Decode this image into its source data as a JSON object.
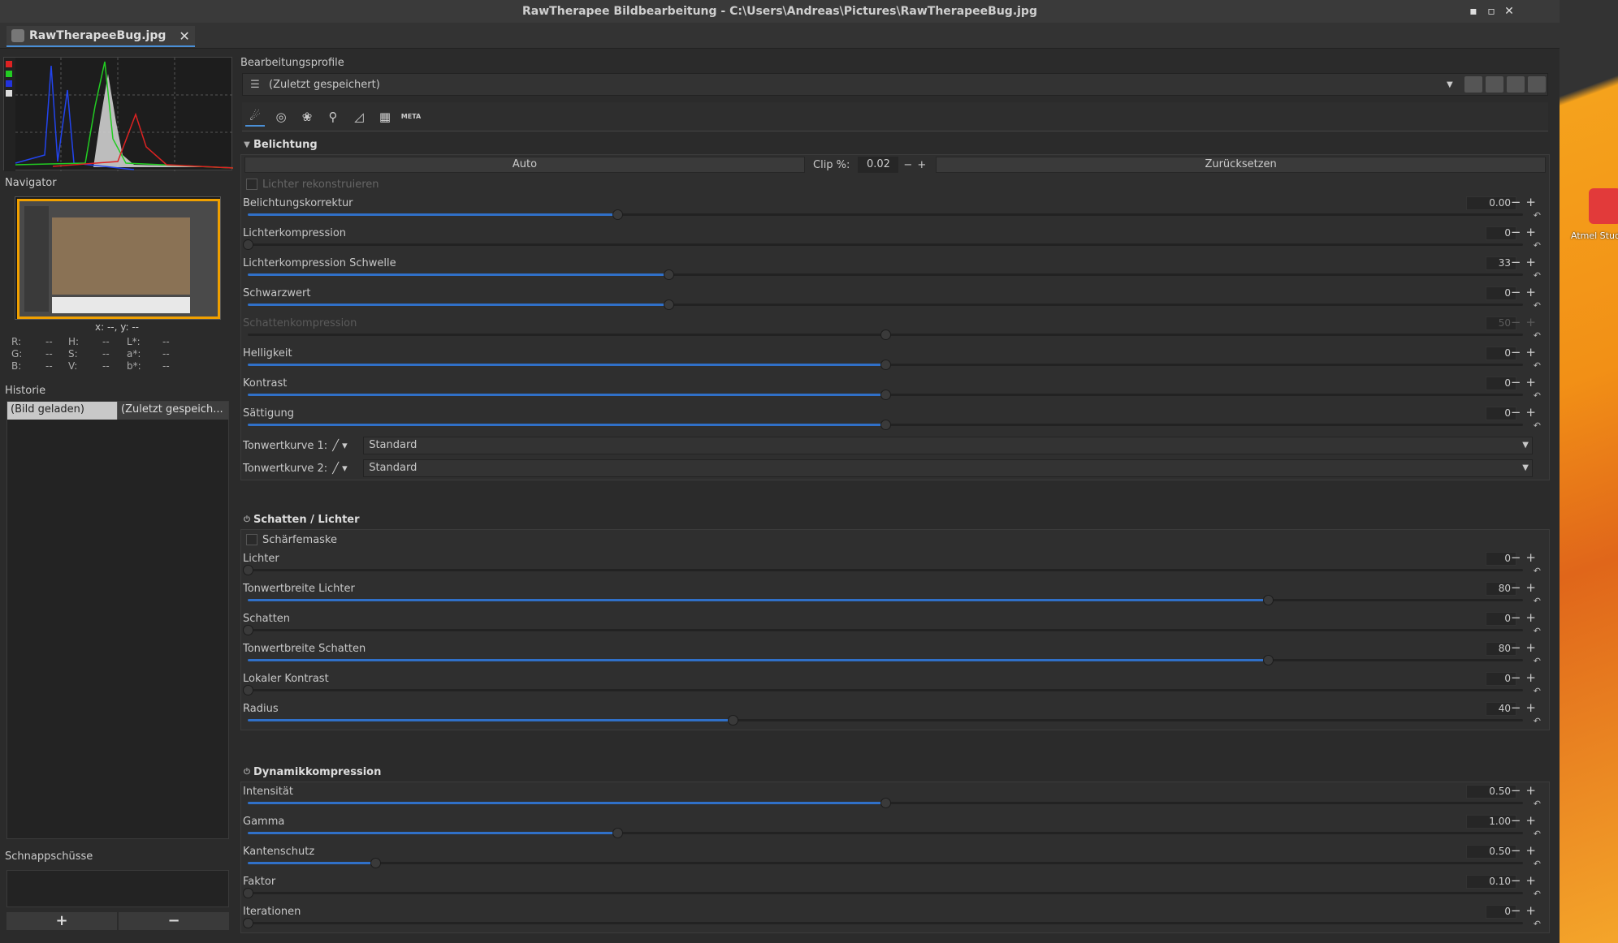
{
  "window": {
    "title": "RawTherapee Bildbearbeitung - C:\\Users\\Andreas\\Pictures\\RawTherapeeBug.jpg",
    "minimize": "▪",
    "maximize": "▫",
    "close": "✕"
  },
  "tab": {
    "label": "RawTherapeeBug.jpg",
    "close": "✕"
  },
  "left": {
    "navigator_label": "Navigator",
    "coords": "x: --, y: --",
    "pixel_rows": [
      [
        "R:",
        "--",
        "H:",
        "--",
        "L*:",
        "--"
      ],
      [
        "G:",
        "--",
        "S:",
        "--",
        "a*:",
        "--"
      ],
      [
        "B:",
        "--",
        "V:",
        "--",
        "b*:",
        "--"
      ]
    ],
    "history_label": "Historie",
    "history": [
      {
        "c1": "(Bild geladen)",
        "c2": "(Zuletzt gespeich..."
      }
    ],
    "snapshots_label": "Schnappschüsse",
    "snap_add": "+",
    "snap_remove": "−"
  },
  "profile": {
    "label": "Bearbeitungsprofile",
    "value": "(Zuletzt gespeichert)"
  },
  "toolbar": {
    "meta": "META"
  },
  "exposure": {
    "title": "Belichtung",
    "auto": "Auto",
    "clip_label": "Clip %:",
    "clip_value": "0.02",
    "reset": "Zurücksetzen",
    "reconstruct": "Lichter rekonstruieren",
    "sliders": [
      {
        "label": "Belichtungskorrektur",
        "value": "0.00",
        "pos": 0.29,
        "fill": 0.29
      },
      {
        "label": "Lichterkompression",
        "value": "0",
        "pos": 0.0,
        "fill": 0
      },
      {
        "label": "Lichterkompression Schwelle",
        "value": "33",
        "pos": 0.33,
        "fill": 0.33
      },
      {
        "label": "Schwarzwert",
        "value": "0",
        "pos": 0.33,
        "fill": 0.33
      },
      {
        "label": "Schattenkompression",
        "value": "50",
        "pos": 0.5,
        "fill": 0,
        "disabled": true
      },
      {
        "label": "Helligkeit",
        "value": "0",
        "pos": 0.5,
        "fill": 0.5
      },
      {
        "label": "Kontrast",
        "value": "0",
        "pos": 0.5,
        "fill": 0.5
      },
      {
        "label": "Sättigung",
        "value": "0",
        "pos": 0.5,
        "fill": 0.5
      }
    ],
    "curve1_label": "Tonwertkurve 1:",
    "curve1_value": "Standard",
    "curve2_label": "Tonwertkurve 2:",
    "curve2_value": "Standard"
  },
  "shadows": {
    "title": "Schatten / Lichter",
    "sharpmask": "Schärfemaske",
    "sliders": [
      {
        "label": "Lichter",
        "value": "0",
        "pos": 0.0,
        "fill": 0
      },
      {
        "label": "Tonwertbreite Lichter",
        "value": "80",
        "pos": 0.8,
        "fill": 0.8
      },
      {
        "label": "Schatten",
        "value": "0",
        "pos": 0.0,
        "fill": 0
      },
      {
        "label": "Tonwertbreite Schatten",
        "value": "80",
        "pos": 0.8,
        "fill": 0.8
      },
      {
        "label": "Lokaler Kontrast",
        "value": "0",
        "pos": 0.0,
        "fill": 0
      },
      {
        "label": "Radius",
        "value": "40",
        "pos": 0.38,
        "fill": 0.38
      }
    ]
  },
  "dynamic": {
    "title": "Dynamikkompression",
    "sliders": [
      {
        "label": "Intensität",
        "value": "0.50",
        "pos": 0.5,
        "fill": 0.5
      },
      {
        "label": "Gamma",
        "value": "1.00",
        "pos": 0.29,
        "fill": 0.29
      },
      {
        "label": "Kantenschutz",
        "value": "0.50",
        "pos": 0.1,
        "fill": 0.1
      },
      {
        "label": "Faktor",
        "value": "0.10",
        "pos": 0.0,
        "fill": 0
      },
      {
        "label": "Iterationen",
        "value": "0",
        "pos": 0.0,
        "fill": 0
      }
    ]
  },
  "desktop": {
    "icon_label": "Atmel Stud"
  }
}
